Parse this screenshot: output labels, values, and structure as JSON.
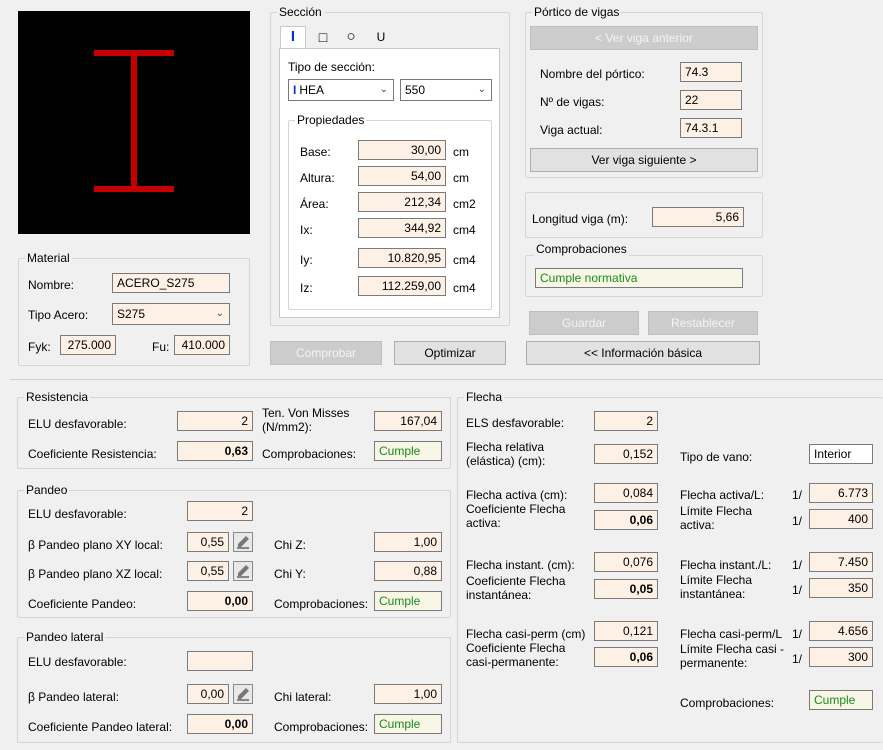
{
  "seccion": {
    "title": "Sección",
    "tabs": [
      "I",
      "□",
      "○",
      "U"
    ],
    "tipo_label": "Tipo de sección:",
    "tipo_value": "HEA",
    "size_value": "550",
    "props_title": "Propiedades",
    "props": [
      {
        "label": "Base:",
        "value": "30,00",
        "unit": "cm"
      },
      {
        "label": "Altura:",
        "value": "54,00",
        "unit": "cm"
      },
      {
        "label": "Área:",
        "value": "212,34",
        "unit": "cm2"
      },
      {
        "label": "Ix:",
        "value": "344,92",
        "unit": "cm4"
      },
      {
        "label": "Iy:",
        "value": "10.820,95",
        "unit": "cm4"
      },
      {
        "label": "Iz:",
        "value": "112.259,00",
        "unit": "cm4"
      }
    ]
  },
  "material": {
    "title": "Material",
    "nombre_label": "Nombre:",
    "nombre_value": "ACERO_S275",
    "tipo_label": "Tipo Acero:",
    "tipo_value": "S275",
    "fyk_label": "Fyk:",
    "fyk_value": "275.000",
    "fu_label": "Fu:",
    "fu_value": "410.000"
  },
  "portico": {
    "title": "Pórtico de vigas",
    "prev_button": "< Ver viga anterior",
    "nombre_label": "Nombre del pórtico:",
    "nombre_value": "74.3",
    "nvigas_label": "Nº de vigas:",
    "nvigas_value": "22",
    "actual_label": "Viga actual:",
    "actual_value": "74.3.1",
    "next_button": "Ver viga siguiente >"
  },
  "longitud": {
    "label": "Longitud viga (m):",
    "value": "5,66"
  },
  "comprobaciones": {
    "title": "Comprobaciones",
    "value": "Cumple normativa"
  },
  "buttons": {
    "guardar": "Guardar",
    "restablecer": "Restablecer",
    "comprobar": "Comprobar",
    "optimizar": "Optimizar",
    "info": "<< Información básica"
  },
  "resistencia": {
    "title": "Resistencia",
    "elu_label": "ELU desfavorable:",
    "elu_value": "2",
    "coef_label": "Coeficiente Resistencia:",
    "coef_value": "0,63",
    "von_label": "Ten. Von Misses (N/mm2):",
    "von_value": "167,04",
    "comp_label": "Comprobaciones:",
    "comp_value": "Cumple"
  },
  "pandeo": {
    "title": "Pandeo",
    "elu_label": "ELU desfavorable:",
    "elu_value": "2",
    "bxy_label": "β Pandeo plano XY local:",
    "bxy_value": "0,55",
    "bxz_label": "β Pandeo plano XZ local:",
    "bxz_value": "0,55",
    "coef_label": "Coeficiente Pandeo:",
    "coef_value": "0,00",
    "chiz_label": "Chi Z:",
    "chiz_value": "1,00",
    "chiy_label": "Chi Y:",
    "chiy_value": "0,88",
    "comp_label": "Comprobaciones:",
    "comp_value": "Cumple"
  },
  "pandeo_lateral": {
    "title": "Pandeo lateral",
    "elu_label": "ELU desfavorable:",
    "elu_value": "",
    "beta_label": "β Pandeo lateral:",
    "beta_value": "0,00",
    "coef_label": "Coeficiente Pandeo lateral:",
    "coef_value": "0,00",
    "chi_label": "Chi lateral:",
    "chi_value": "1,00",
    "comp_label": "Comprobaciones:",
    "comp_value": "Cumple"
  },
  "flecha": {
    "title": "Flecha",
    "els_label": "ELS desfavorable:",
    "els_value": "2",
    "rel_label": "Flecha relativa (elástica) (cm):",
    "rel_value": "0,152",
    "tipo_label": "Tipo de vano:",
    "tipo_value": "Interior",
    "activa_label": "Flecha activa (cm):",
    "activa_value": "0,084",
    "activa_l_label": "Flecha activa/L:",
    "activa_l_value": "6.773",
    "coef_activa_label": "Coeficiente Flecha activa:",
    "coef_activa_value": "0,06",
    "lim_activa_label": "Límite Flecha activa:",
    "lim_activa_value": "400",
    "inst_label": "Flecha instant. (cm):",
    "inst_value": "0,076",
    "inst_l_label": "Flecha instant./L:",
    "inst_l_value": "7.450",
    "coef_inst_label": "Coeficiente Flecha instantánea:",
    "coef_inst_value": "0,05",
    "lim_inst_label": "Límite Flecha instantánea:",
    "lim_inst_value": "350",
    "casi_label": "Flecha casi-perm (cm)",
    "casi_value": "0,121",
    "casi_l_label": "Flecha casi-perm/L",
    "casi_l_value": "4.656",
    "coef_casi_label": "Coeficiente Flecha casi-permanente:",
    "coef_casi_value": "0,06",
    "lim_casi_label": "Límite Flecha casi -permanente:",
    "lim_casi_value": "300",
    "ratio_prefix": "1/",
    "comp_label": "Comprobaciones:",
    "comp_value": "Cumple"
  },
  "colors": {
    "section_red": "#c40000",
    "accent_blue": "#0033cc",
    "input_bg": "#fdf0e4",
    "pass_green": "#1a8a1a"
  }
}
